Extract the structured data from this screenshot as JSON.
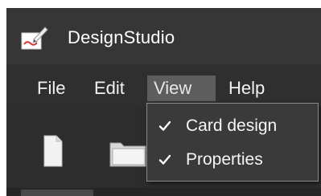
{
  "app": {
    "title": "DesignStudio",
    "icon": "app-edit-icon"
  },
  "menubar": {
    "items": [
      {
        "label": "File",
        "active": false
      },
      {
        "label": "Edit",
        "active": false
      },
      {
        "label": "View",
        "active": true
      },
      {
        "label": "Help",
        "active": false
      }
    ]
  },
  "toolbar": {
    "buttons": [
      {
        "icon": "new-document-icon"
      },
      {
        "icon": "open-folder-icon"
      }
    ]
  },
  "view_menu": {
    "items": [
      {
        "label": "Card design",
        "checked": true
      },
      {
        "label": "Properties",
        "checked": true
      }
    ]
  },
  "colors": {
    "window_bg": "#2f2f2f",
    "titlebar_bg": "#363636",
    "menu_active_bg": "#5d5d5d",
    "dropdown_bg": "#3a3a3a",
    "dropdown_border": "#8a8a8a",
    "text": "#f2f2f2"
  }
}
